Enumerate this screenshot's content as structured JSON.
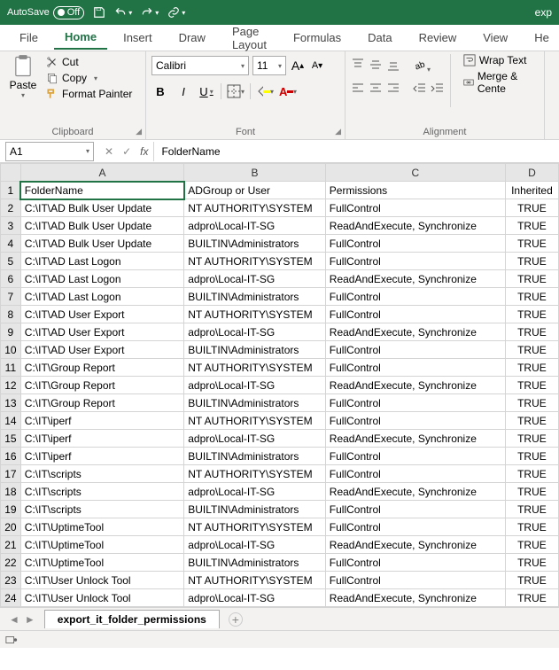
{
  "titlebar": {
    "autosave_label": "AutoSave",
    "autosave_state": "Off",
    "doc_title": "exp"
  },
  "menu": {
    "file": "File",
    "home": "Home",
    "insert": "Insert",
    "draw": "Draw",
    "page_layout": "Page Layout",
    "formulas": "Formulas",
    "data": "Data",
    "review": "Review",
    "view": "View",
    "help": "He"
  },
  "ribbon": {
    "clipboard": {
      "paste": "Paste",
      "cut": "Cut",
      "copy": "Copy",
      "format_painter": "Format Painter",
      "label": "Clipboard"
    },
    "font": {
      "name": "Calibri",
      "size": "11",
      "bold": "B",
      "italic": "I",
      "underline": "U",
      "label": "Font",
      "increase_a": "A",
      "decrease_a": "A"
    },
    "alignment": {
      "wrap": "Wrap Text",
      "merge": "Merge & Cente",
      "label": "Alignment"
    }
  },
  "namebox": {
    "cell": "A1"
  },
  "formula_bar": {
    "value": "FolderName"
  },
  "columns": [
    "A",
    "B",
    "C",
    "D"
  ],
  "headers": {
    "A": "FolderName",
    "B": "ADGroup or User",
    "C": "Permissions",
    "D": "Inherited"
  },
  "rows": [
    {
      "n": 2,
      "A": "C:\\IT\\AD Bulk User Update",
      "B": "NT AUTHORITY\\SYSTEM",
      "C": "FullControl",
      "D": "TRUE"
    },
    {
      "n": 3,
      "A": "C:\\IT\\AD Bulk User Update",
      "B": "adpro\\Local-IT-SG",
      "C": "ReadAndExecute, Synchronize",
      "D": "TRUE"
    },
    {
      "n": 4,
      "A": "C:\\IT\\AD Bulk User Update",
      "B": "BUILTIN\\Administrators",
      "C": "FullControl",
      "D": "TRUE"
    },
    {
      "n": 5,
      "A": "C:\\IT\\AD Last Logon",
      "B": "NT AUTHORITY\\SYSTEM",
      "C": "FullControl",
      "D": "TRUE"
    },
    {
      "n": 6,
      "A": "C:\\IT\\AD Last Logon",
      "B": "adpro\\Local-IT-SG",
      "C": "ReadAndExecute, Synchronize",
      "D": "TRUE"
    },
    {
      "n": 7,
      "A": "C:\\IT\\AD Last Logon",
      "B": "BUILTIN\\Administrators",
      "C": "FullControl",
      "D": "TRUE"
    },
    {
      "n": 8,
      "A": "C:\\IT\\AD User Export",
      "B": "NT AUTHORITY\\SYSTEM",
      "C": "FullControl",
      "D": "TRUE"
    },
    {
      "n": 9,
      "A": "C:\\IT\\AD User Export",
      "B": "adpro\\Local-IT-SG",
      "C": "ReadAndExecute, Synchronize",
      "D": "TRUE"
    },
    {
      "n": 10,
      "A": "C:\\IT\\AD User Export",
      "B": "BUILTIN\\Administrators",
      "C": "FullControl",
      "D": "TRUE"
    },
    {
      "n": 11,
      "A": "C:\\IT\\Group Report",
      "B": "NT AUTHORITY\\SYSTEM",
      "C": "FullControl",
      "D": "TRUE"
    },
    {
      "n": 12,
      "A": "C:\\IT\\Group Report",
      "B": "adpro\\Local-IT-SG",
      "C": "ReadAndExecute, Synchronize",
      "D": "TRUE"
    },
    {
      "n": 13,
      "A": "C:\\IT\\Group Report",
      "B": "BUILTIN\\Administrators",
      "C": "FullControl",
      "D": "TRUE"
    },
    {
      "n": 14,
      "A": "C:\\IT\\iperf",
      "B": "NT AUTHORITY\\SYSTEM",
      "C": "FullControl",
      "D": "TRUE"
    },
    {
      "n": 15,
      "A": "C:\\IT\\iperf",
      "B": "adpro\\Local-IT-SG",
      "C": "ReadAndExecute, Synchronize",
      "D": "TRUE"
    },
    {
      "n": 16,
      "A": "C:\\IT\\iperf",
      "B": "BUILTIN\\Administrators",
      "C": "FullControl",
      "D": "TRUE"
    },
    {
      "n": 17,
      "A": "C:\\IT\\scripts",
      "B": "NT AUTHORITY\\SYSTEM",
      "C": "FullControl",
      "D": "TRUE"
    },
    {
      "n": 18,
      "A": "C:\\IT\\scripts",
      "B": "adpro\\Local-IT-SG",
      "C": "ReadAndExecute, Synchronize",
      "D": "TRUE"
    },
    {
      "n": 19,
      "A": "C:\\IT\\scripts",
      "B": "BUILTIN\\Administrators",
      "C": "FullControl",
      "D": "TRUE"
    },
    {
      "n": 20,
      "A": "C:\\IT\\UptimeTool",
      "B": "NT AUTHORITY\\SYSTEM",
      "C": "FullControl",
      "D": "TRUE"
    },
    {
      "n": 21,
      "A": "C:\\IT\\UptimeTool",
      "B": "adpro\\Local-IT-SG",
      "C": "ReadAndExecute, Synchronize",
      "D": "TRUE"
    },
    {
      "n": 22,
      "A": "C:\\IT\\UptimeTool",
      "B": "BUILTIN\\Administrators",
      "C": "FullControl",
      "D": "TRUE"
    },
    {
      "n": 23,
      "A": "C:\\IT\\User Unlock Tool",
      "B": "NT AUTHORITY\\SYSTEM",
      "C": "FullControl",
      "D": "TRUE"
    },
    {
      "n": 24,
      "A": "C:\\IT\\User Unlock Tool",
      "B": "adpro\\Local-IT-SG",
      "C": "ReadAndExecute, Synchronize",
      "D": "TRUE"
    }
  ],
  "sheet_tab": {
    "name": "export_it_folder_permissions"
  }
}
